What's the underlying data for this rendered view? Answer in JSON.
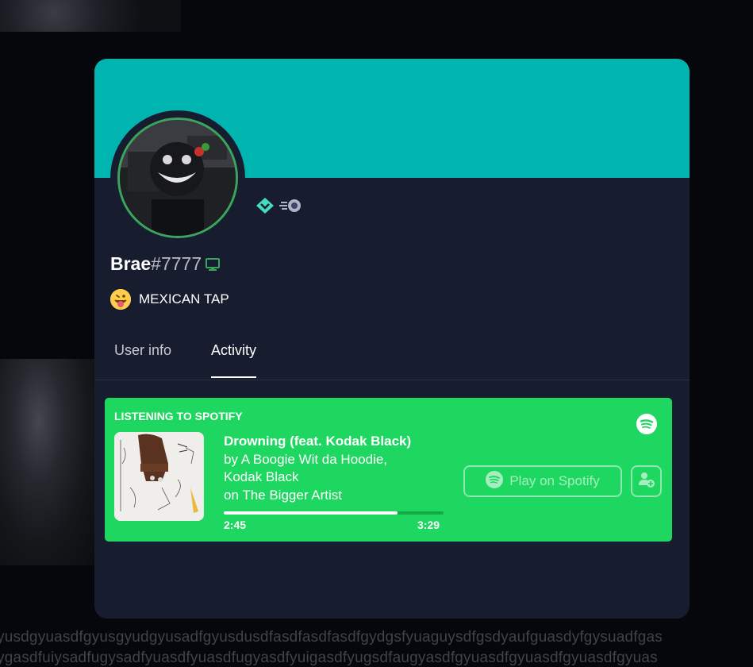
{
  "background": {
    "text_line_1": "yusdgyuasdfgyusgyudgyusadfgyusdusdfasdfasdfasdfgydgsfyuaguysdfgsdyaufguasdyfgysuadfgas",
    "text_line_2": "ygasdfuiysadfugysadfyuasdfyuasdfugyasdfyuigasdfyugsdfaugyasdfgyuasdfgyuasdfgyuasdfgyuas"
  },
  "colors": {
    "banner": "#00b5b0",
    "card": "#181c2f",
    "spotify_green": "#1ed760",
    "online_ring": "#3ba55d"
  },
  "profile": {
    "username": "Brae",
    "discriminator": "#7777",
    "device_icon": "desktop-icon",
    "badges": [
      "hypesquad-brilliance-icon",
      "nitro-boost-icon"
    ],
    "status_emoji": "😛",
    "status_text": "MEXICAN TAP"
  },
  "tabs": [
    {
      "label": "User info",
      "active": false
    },
    {
      "label": "Activity",
      "active": true
    }
  ],
  "activity": {
    "header": "LISTENING TO SPOTIFY",
    "track_title": "Drowning (feat. Kodak Black)",
    "artists_line_1": "by A Boogie Wit da Hoodie,",
    "artists_line_2": "Kodak Black",
    "album_line": "on The Bigger Artist",
    "elapsed": "2:45",
    "total": "3:29",
    "progress_fraction": 0.79,
    "play_button_label": "Play on Spotify",
    "invite_icon": "add-user-icon"
  }
}
